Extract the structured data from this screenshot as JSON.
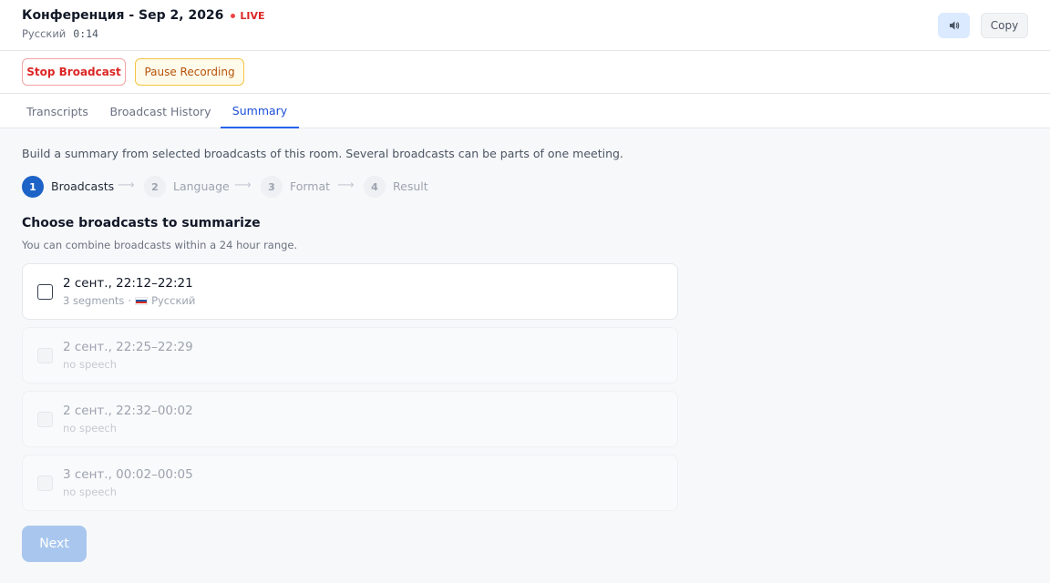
{
  "header": {
    "title": "Конференция - Sep 2, 2026",
    "live_label": "LIVE",
    "language": "Русский",
    "timer": "0:14",
    "speaker_icon": "speaker-icon",
    "copy_label": "Copy"
  },
  "actions": {
    "stop_label": "Stop Broadcast",
    "pause_label": "Pause Recording"
  },
  "tabs": [
    {
      "label": "Transcripts",
      "active": false
    },
    {
      "label": "Broadcast History",
      "active": false
    },
    {
      "label": "Summary",
      "active": true
    }
  ],
  "summary": {
    "intro": "Build a summary from selected broadcasts of this room. Several broadcasts can be parts of one meeting.",
    "steps": [
      {
        "number": "1",
        "label": "Broadcasts",
        "active": true
      },
      {
        "number": "2",
        "label": "Language",
        "active": false
      },
      {
        "number": "3",
        "label": "Format",
        "active": false
      },
      {
        "number": "4",
        "label": "Result",
        "active": false
      }
    ],
    "step_arrow": "⟶",
    "choose_title": "Choose broadcasts to summarize",
    "choose_hint": "You can combine broadcasts within a 24 hour range.",
    "broadcasts": [
      {
        "time": "2 сент., 22:12–22:21",
        "segments": "3 segments",
        "separator": "·",
        "language": "Русский",
        "flag": "ru-flag",
        "enabled": true,
        "checked": false
      },
      {
        "time": "2 сент., 22:25–22:29",
        "note": "no speech",
        "enabled": false,
        "checked": false
      },
      {
        "time": "2 сент., 22:32–00:02",
        "note": "no speech",
        "enabled": false,
        "checked": false
      },
      {
        "time": "3 сент., 00:02–00:05",
        "note": "no speech",
        "enabled": false,
        "checked": false
      }
    ],
    "next_label": "Next"
  },
  "colors": {
    "accent": "#2563eb",
    "live": "#dc2626",
    "stop": "#dc2626",
    "pause": "#b45309",
    "next_disabled": "#a9c7ee"
  }
}
